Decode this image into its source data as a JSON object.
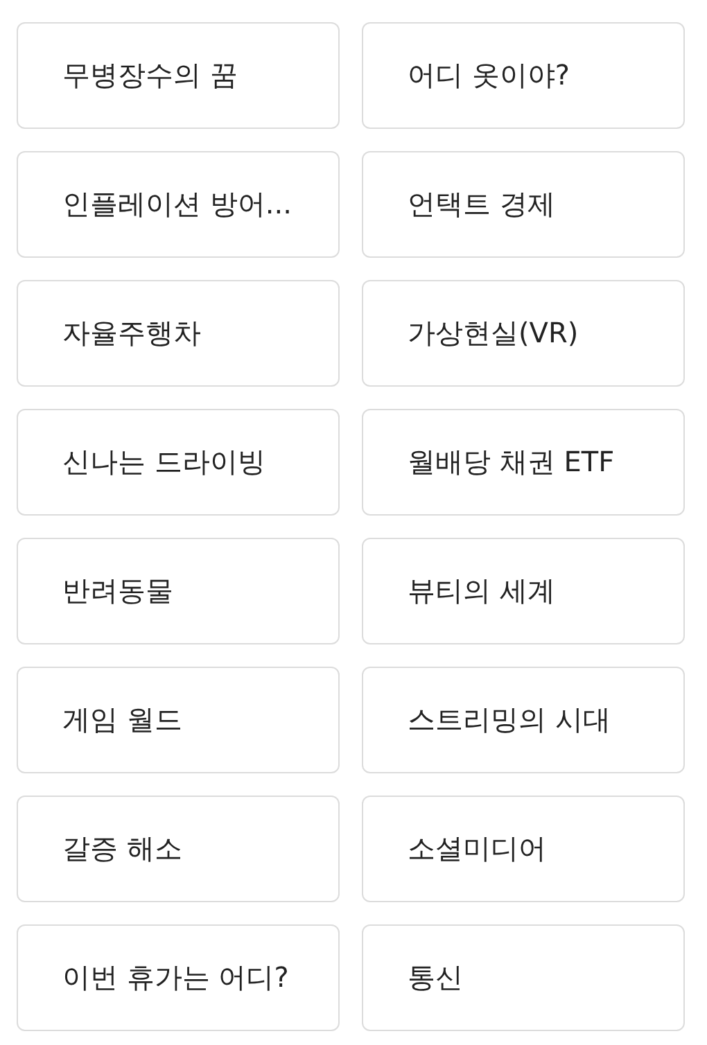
{
  "topics": [
    {
      "label": "무병장수의 꿈"
    },
    {
      "label": "어디 옷이야?"
    },
    {
      "label": "인플레이션 방어..."
    },
    {
      "label": "언택트 경제"
    },
    {
      "label": "자율주행차"
    },
    {
      "label": "가상현실(VR)"
    },
    {
      "label": "신나는 드라이빙"
    },
    {
      "label": "월배당 채권 ETF"
    },
    {
      "label": "반려동물"
    },
    {
      "label": "뷰티의 세계"
    },
    {
      "label": "게임 월드"
    },
    {
      "label": "스트리밍의 시대"
    },
    {
      "label": "갈증 해소"
    },
    {
      "label": "소셜미디어"
    },
    {
      "label": "이번 휴가는 어디?"
    },
    {
      "label": "통신"
    }
  ]
}
